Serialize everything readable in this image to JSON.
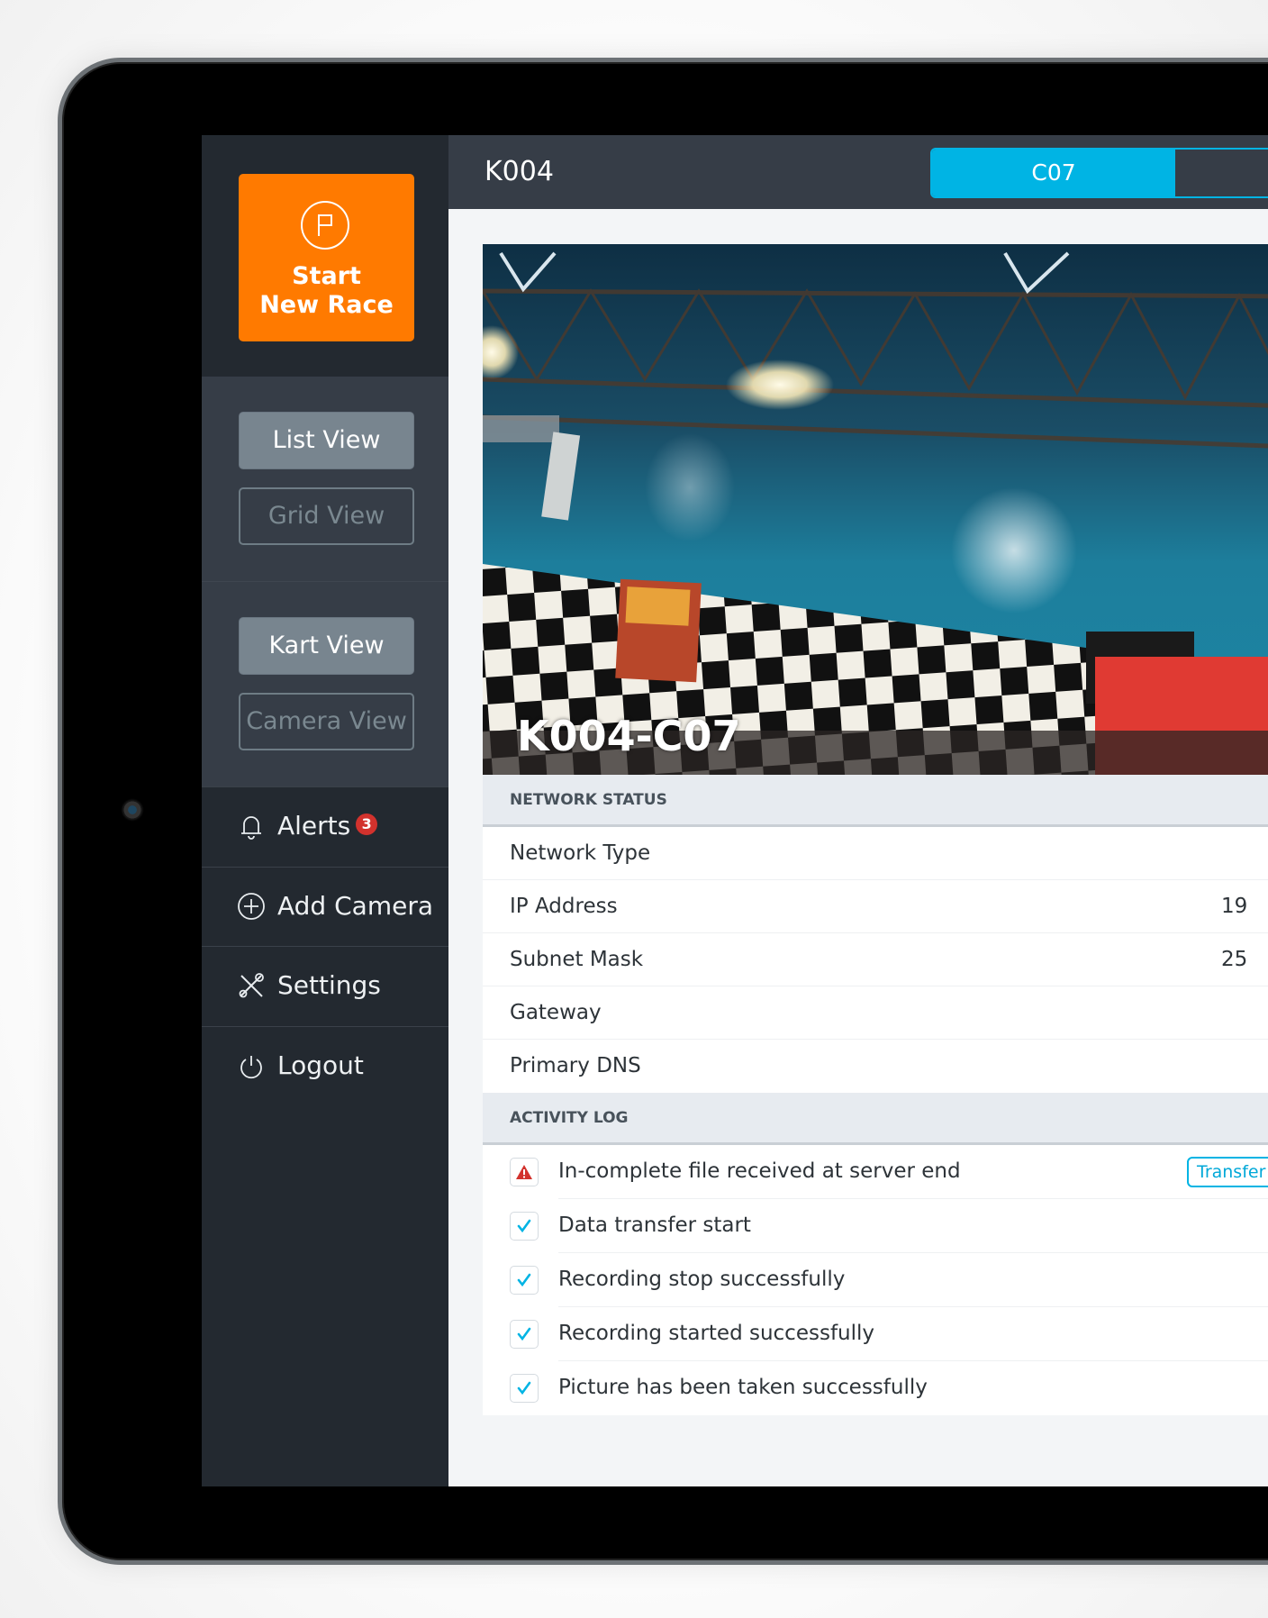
{
  "sidebar": {
    "start_button": {
      "label_line1": "Start",
      "label_line2": "New Race",
      "icon": "flag-icon"
    },
    "view_group_1": [
      {
        "label": "List View",
        "active": true
      },
      {
        "label": "Grid View",
        "active": false
      }
    ],
    "view_group_2": [
      {
        "label": "Kart View",
        "active": true
      },
      {
        "label": "Camera View",
        "active": false
      }
    ],
    "nav": [
      {
        "label": "Alerts",
        "icon": "bell-icon",
        "badge": "3"
      },
      {
        "label": "Add Camera",
        "icon": "plus-circle-icon"
      },
      {
        "label": "Settings",
        "icon": "tools-icon"
      },
      {
        "label": "Logout",
        "icon": "power-icon"
      }
    ]
  },
  "header": {
    "title": "K004",
    "tabs": [
      {
        "label": "C07",
        "active": true
      },
      {
        "label": "",
        "active": false
      }
    ]
  },
  "feed": {
    "overlay_label": "K004-C07"
  },
  "network_status": {
    "heading": "NETWORK STATUS",
    "rows": [
      {
        "label": "Network Type",
        "value": ""
      },
      {
        "label": "IP Address",
        "value": "19"
      },
      {
        "label": "Subnet Mask",
        "value": "25"
      },
      {
        "label": "Gateway",
        "value": ""
      },
      {
        "label": "Primary DNS",
        "value": ""
      }
    ]
  },
  "activity_log": {
    "heading": "ACTIVITY LOG",
    "items": [
      {
        "text": "In-complete file received at server end",
        "status": "warning",
        "action": "Transfer"
      },
      {
        "text": "Data transfer start",
        "status": "success"
      },
      {
        "text": "Recording stop successfully",
        "status": "success"
      },
      {
        "text": "Recording started successfully",
        "status": "success"
      },
      {
        "text": "Picture has been taken successfully",
        "status": "success"
      }
    ]
  },
  "colors": {
    "accent_orange": "#ff7a00",
    "accent_blue": "#00b4e4",
    "alert_red": "#d2322d",
    "sidebar_bg": "#232930",
    "header_bg": "#363d47"
  }
}
